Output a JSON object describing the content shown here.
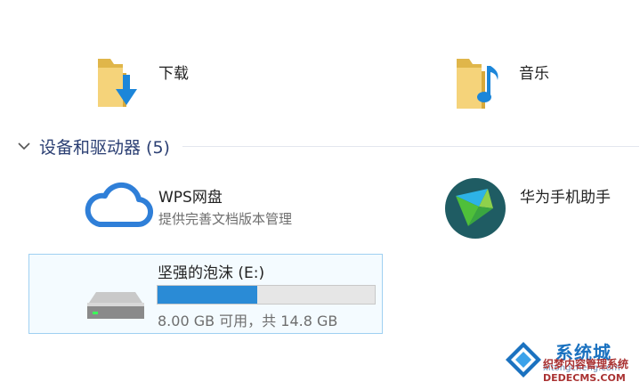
{
  "folders": [
    {
      "label": "下载",
      "icon": "downloads-folder-icon"
    },
    {
      "label": "音乐",
      "icon": "music-folder-icon"
    }
  ],
  "section": {
    "title": "设备和驱动器 (5)",
    "icon": "chevron-down-icon"
  },
  "devices": [
    {
      "name": "WPS网盘",
      "subtitle": "提供完善文档版本管理",
      "icon": "cloud-icon"
    },
    {
      "name": "华为手机助手",
      "icon": "huawei-hisuite-icon"
    }
  ],
  "drive": {
    "name": "坚强的泡沫 (E:)",
    "space_text": "8.00 GB 可用，共 14.8 GB",
    "used_fraction": 0.46,
    "icon": "removable-drive-icon",
    "bar_color": "#2a8bd6"
  },
  "watermark": {
    "line1": "系统城",
    "line2": "xitongcheng.com",
    "line3": "织梦内容管理系统",
    "line4": "DEDECMS.COM"
  }
}
